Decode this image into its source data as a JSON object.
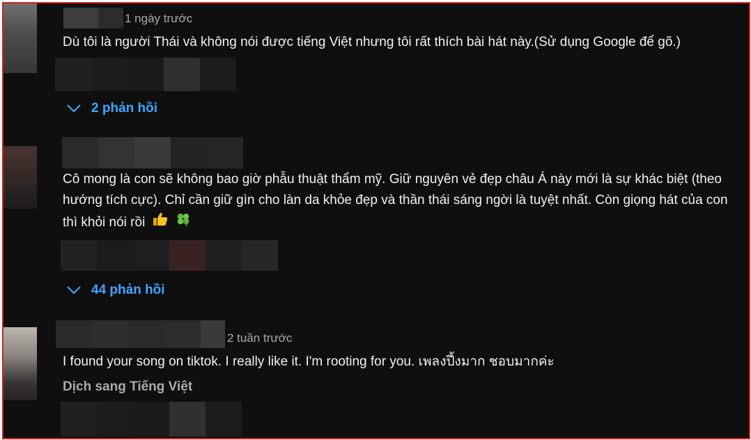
{
  "comments": [
    {
      "timestamp": "1 ngày trước",
      "text": "Dù tôi là người Thái và không nói được tiếng Việt nhưng tôi rất thích bài hát này.(Sử dụng Google để gõ.)",
      "replies_label": "2 phản hồi"
    },
    {
      "text": "Cô mong là con sẽ không bao giờ phẫu thuật thẩm mỹ. Giữ nguyên vẻ đẹp châu Á này mới là sự khác biệt (theo hướng tích cực). Chỉ cần giữ gìn cho làn da khỏe đẹp và thần thái sáng ngời là tuyệt nhất. Còn giọng hát của con thì khỏi nói rồi",
      "emojis": [
        "thumbs-up-icon",
        "four-leaf-clover-icon"
      ],
      "replies_label": "44 phản hồi"
    },
    {
      "timestamp": "2 tuần trước",
      "text": "I found your song on tiktok. I really like it. I'm rooting for you. เพลงปึ้งมาก ชอบมากค่ะ",
      "translate_label": "Dịch sang Tiếng Việt"
    }
  ],
  "colors": {
    "background": "#0f0f0f",
    "text": "#f1f1f1",
    "meta": "#aaaaaa",
    "link": "#3ea6ff",
    "frame": "#d21f1f"
  }
}
